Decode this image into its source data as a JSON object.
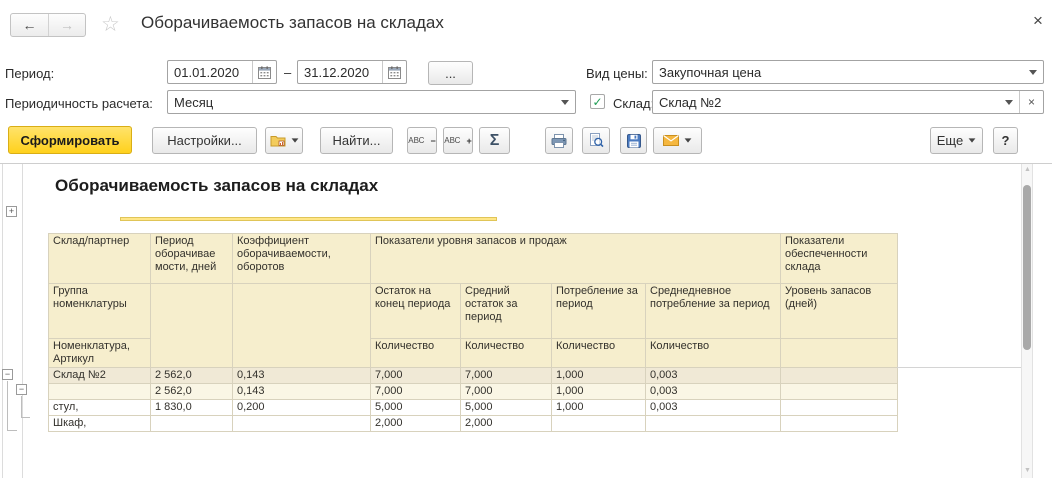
{
  "window": {
    "close": "×"
  },
  "nav": {
    "title": "Оборачиваемость запасов на складах"
  },
  "icons": {
    "back": "←",
    "forward": "→",
    "favorite_star": "☆",
    "close": "×",
    "dropdown_arrow": "▼",
    "clear": "×",
    "checkbox_check": "✓",
    "expand_node": "+",
    "collapse_node": "−",
    "scroll_up": "▲",
    "scroll_down": "▼"
  },
  "filters": {
    "period_label": "Период:",
    "date_from": "01.01.2020",
    "date_range_dash": "–",
    "date_to": "31.12.2020",
    "period_more": "...",
    "periodicity_label": "Периодичность расчета:",
    "periodicity_value": "Месяц",
    "price_label": "Вид цены:",
    "price_value": "Закупочная цена",
    "warehouse_label": "Склад:",
    "warehouse_value": "Склад №2"
  },
  "toolbar": {
    "generate": "Сформировать",
    "settings": "Настройки...",
    "find": "Найти...",
    "abc": "АВС",
    "minus": "−",
    "plus": "+",
    "sigma": "Σ",
    "more": "Еще",
    "help": "?"
  },
  "colors": {
    "accent_yellow": "#ffd11c",
    "header_cell": "#f6eecd",
    "group_row": "#f0e9d6",
    "subgroup_row": "#faf6e5"
  },
  "report": {
    "title": "Оборачиваемость запасов на складах",
    "table": {
      "headers": {
        "warehouse_partner": "Склад/партнер",
        "turnover_period": "Период оборачивае мости, дней",
        "turnover_ratio": "Коэффициент оборачиваемости, оборотов",
        "stock_sales_group": "Показатели уровня запасов и продаж",
        "supply_group": "Показатели обеспеченности склада",
        "nomenclature_group": "Группа номенклатуры",
        "end_balance": "Остаток на конец периода",
        "avg_balance": "Средний остаток за период",
        "consumption": "Потребление за период",
        "daily_consumption": "Среднедневное потребление за период",
        "stock_level": "Уровень запасов (дней)",
        "nomenclature": "Номенклатура, Артикул",
        "qty": [
          "Количество",
          "Количество",
          "Количество",
          "Количество"
        ]
      },
      "rows": [
        {
          "level": "group1",
          "name": "Склад №2",
          "cells": [
            "2 562,0",
            "0,143",
            "7,000",
            "7,000",
            "1,000",
            "0,003",
            ""
          ]
        },
        {
          "level": "group2",
          "name": "",
          "cells": [
            "2 562,0",
            "0,143",
            "7,000",
            "7,000",
            "1,000",
            "0,003",
            ""
          ]
        },
        {
          "level": "item",
          "name": "стул,",
          "cells": [
            "1 830,0",
            "0,200",
            "5,000",
            "5,000",
            "1,000",
            "0,003",
            ""
          ]
        },
        {
          "level": "item",
          "name": "Шкаф,",
          "cells": [
            "",
            "",
            "2,000",
            "2,000",
            "",
            "",
            ""
          ]
        }
      ]
    }
  }
}
